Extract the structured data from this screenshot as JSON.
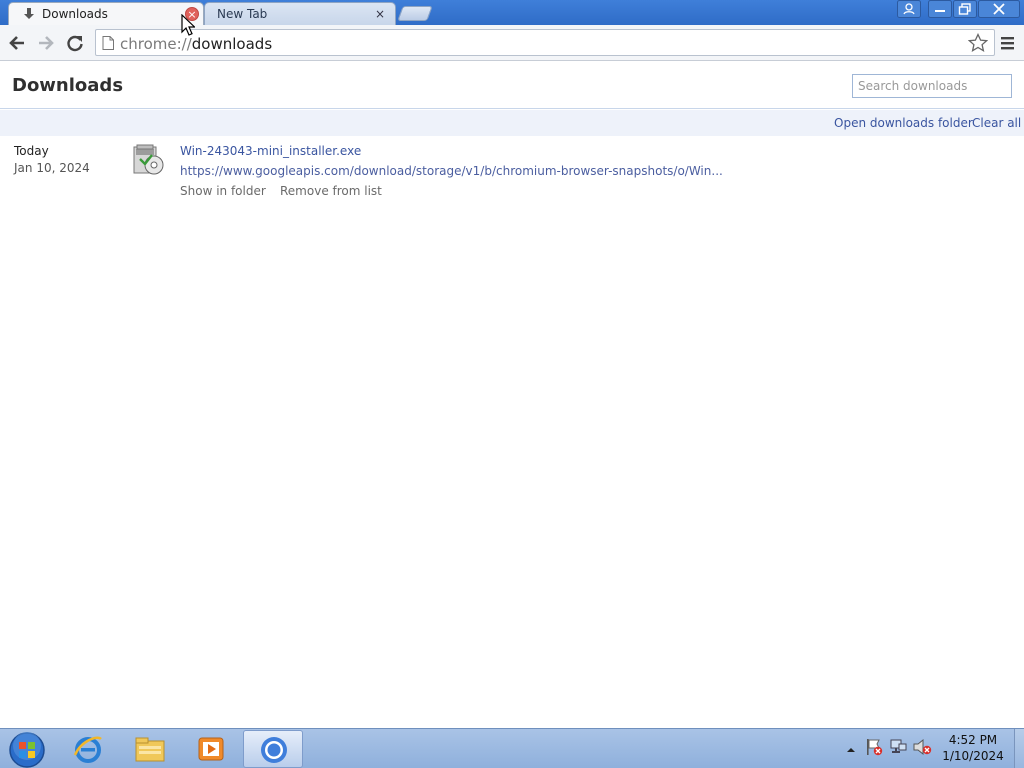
{
  "tabs": [
    {
      "title": "Downloads",
      "icon": "download-arrow-icon",
      "active": true
    },
    {
      "title": "New Tab",
      "active": false
    }
  ],
  "omnibox": {
    "scheme": "chrome://",
    "path": "downloads"
  },
  "page": {
    "title": "Downloads",
    "search_placeholder": "Search downloads",
    "open_folder_label": "Open downloads folder",
    "clear_all_label": "Clear all"
  },
  "download": {
    "day": "Today",
    "date": "Jan 10, 2024",
    "filename": "Win-243043-mini_installer.exe",
    "url": "https://www.googleapis.com/download/storage/v1/b/chromium-browser-snapshots/o/Win...",
    "show_in_folder": "Show in folder",
    "remove_from_list": "Remove from list",
    "icon": "installer-file-icon"
  },
  "taskbar": {
    "apps": [
      "internet-explorer-icon",
      "file-explorer-icon",
      "media-player-icon",
      "chrome-icon"
    ],
    "time": "4:52 PM",
    "date": "1/10/2024"
  },
  "colors": {
    "link": "#3a55a0",
    "titlebar": "#3574d0",
    "accent_bar": "#eef2fa"
  }
}
